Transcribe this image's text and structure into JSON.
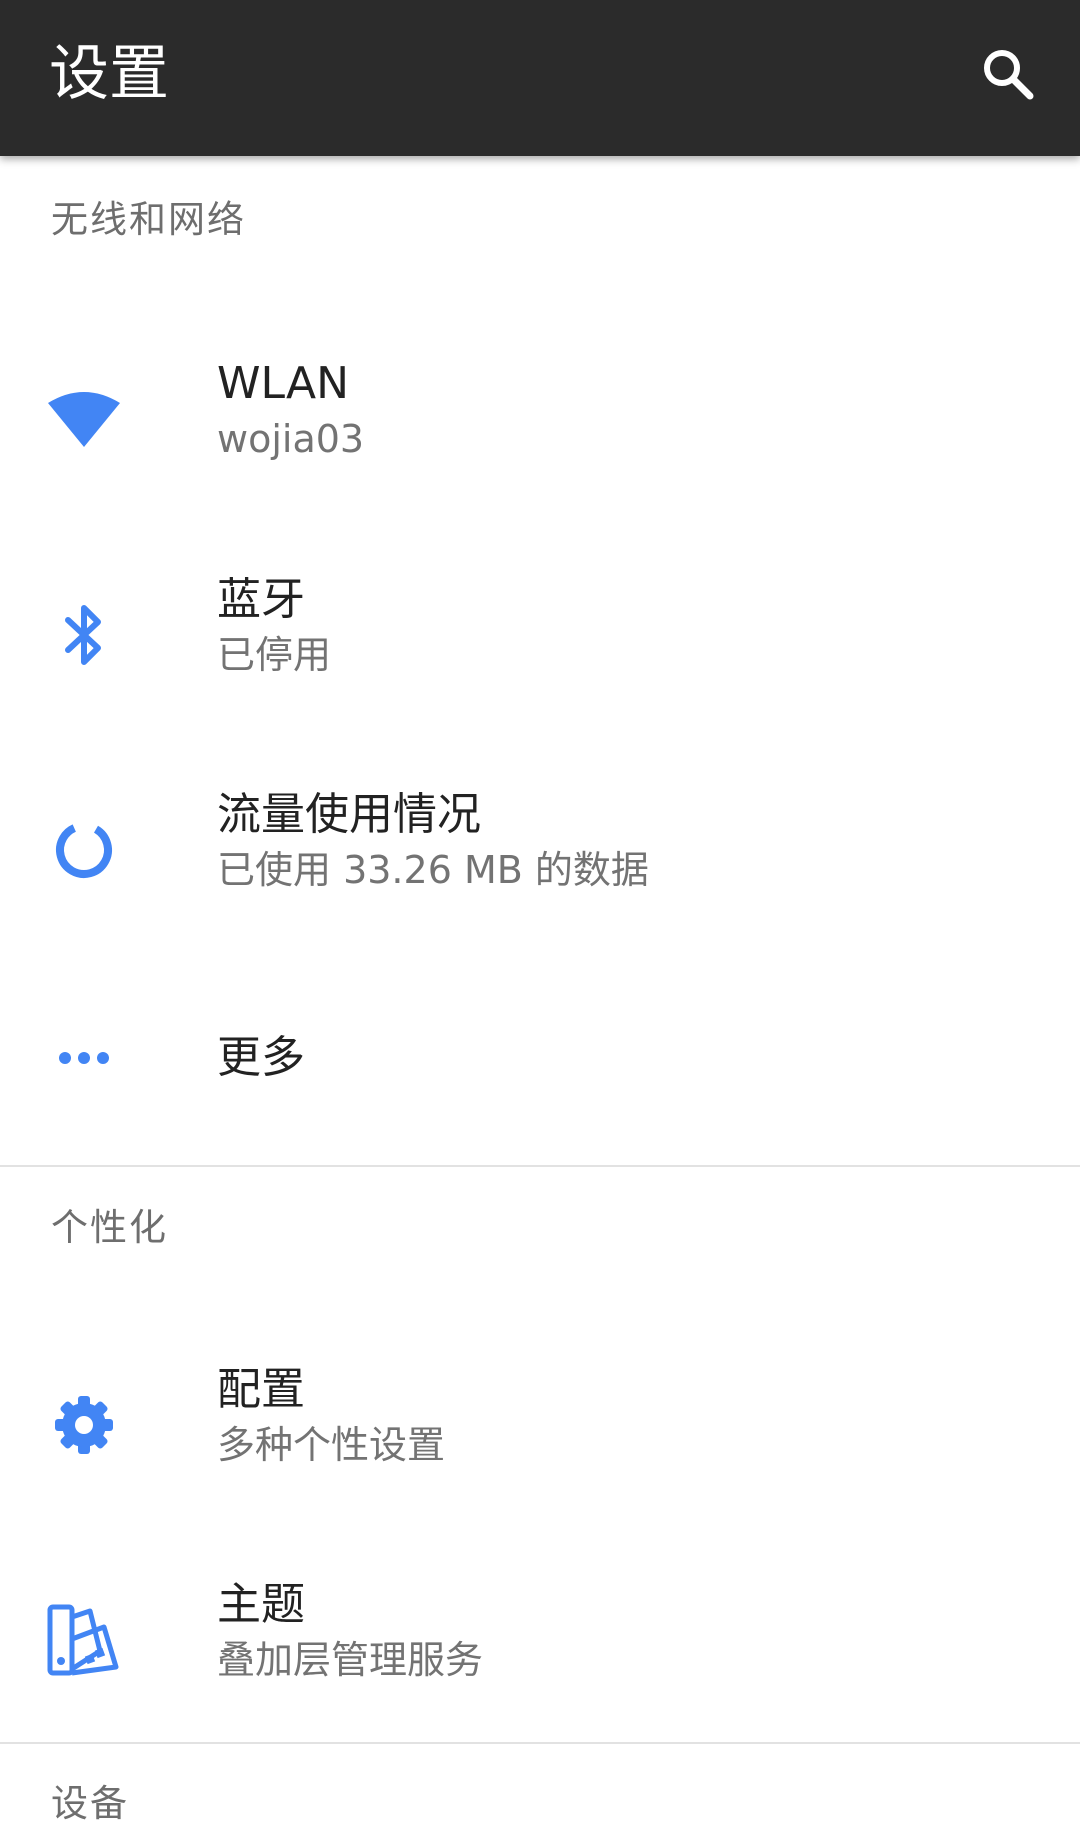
{
  "appbar": {
    "title": "设置",
    "search_icon": "search-icon"
  },
  "sections": {
    "wireless": {
      "header": "无线和网络",
      "items": [
        {
          "title": "WLAN",
          "summary": "wojia03",
          "icon": "wifi-icon"
        },
        {
          "title": "蓝牙",
          "summary": "已停用",
          "icon": "bluetooth-icon"
        },
        {
          "title": "流量使用情况",
          "summary": "已使用 33.26 MB 的数据",
          "icon": "data-usage-icon"
        },
        {
          "title": "更多",
          "icon": "more-icon"
        }
      ]
    },
    "personal": {
      "header": "个性化",
      "items": [
        {
          "title": "配置",
          "summary": "多种个性设置",
          "icon": "gear-icon"
        },
        {
          "title": "主题",
          "summary": "叠加层管理服务",
          "icon": "theme-palette-icon"
        }
      ]
    },
    "device": {
      "header": "设备"
    }
  },
  "colors": {
    "appbar_bg": "#2b2b2b",
    "accent": "#4285f4",
    "title_text": "#222222",
    "summary_text": "#737373",
    "header_text": "#6e6e6e",
    "divider": "#e2e2e2"
  }
}
